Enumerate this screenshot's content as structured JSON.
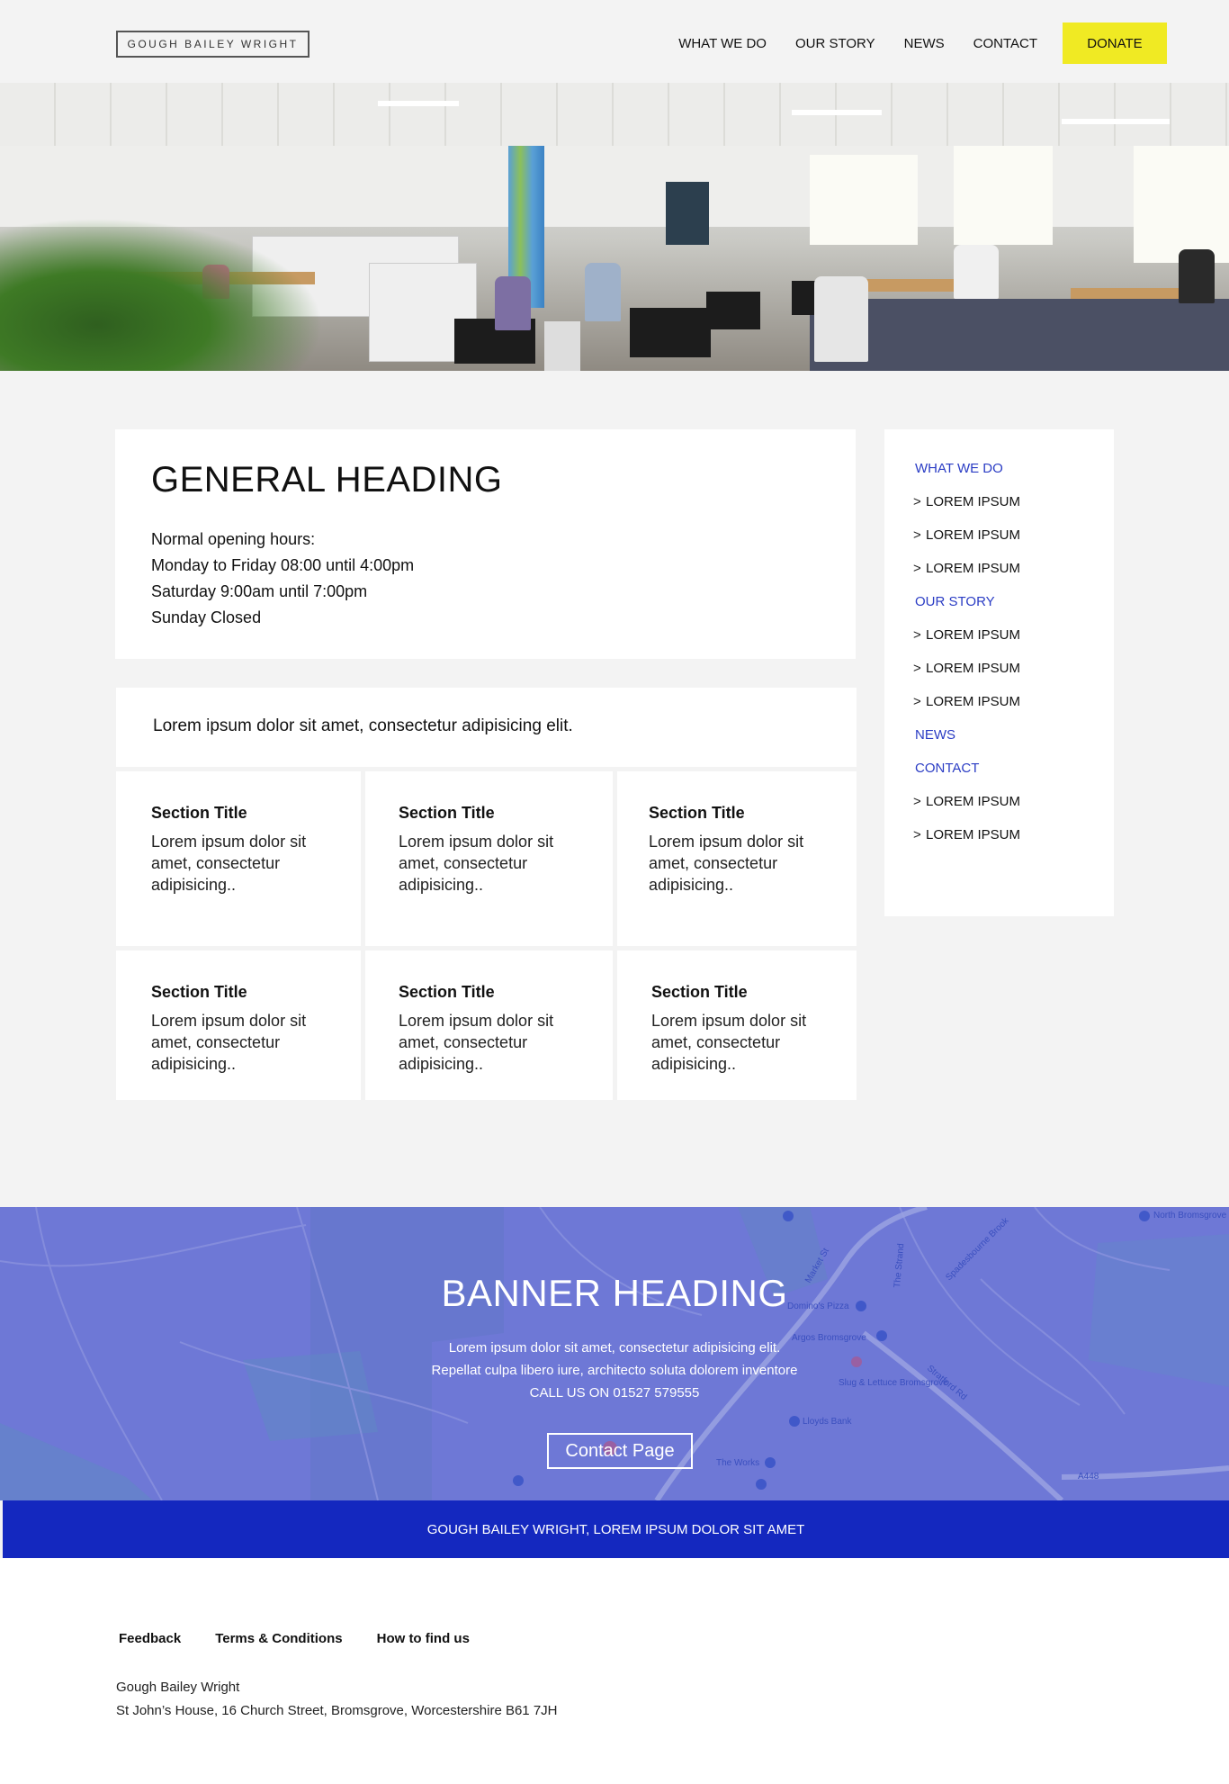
{
  "header": {
    "logo": "GOUGH BAILEY WRIGHT",
    "nav": [
      "WHAT WE DO",
      "OUR STORY",
      "NEWS",
      "CONTACT"
    ],
    "donate": "DONATE",
    "donate_color": "#f0ea23"
  },
  "general": {
    "heading": "GENERAL HEADING",
    "hours": [
      "Normal opening hours:",
      "Monday to Friday 08:00 until 4:00pm",
      "Saturday 9:00am until 7:00pm",
      "Sunday Closed"
    ]
  },
  "intro": "Lorem ipsum dolor sit amet, consectetur adipisicing elit.",
  "tiles": [
    {
      "title": "Section Title",
      "text": "Lorem ipsum dolor sit amet, consectetur adipisicing.."
    },
    {
      "title": "Section Title",
      "text": "Lorem ipsum dolor sit amet, consectetur adipisicing.."
    },
    {
      "title": "Section Title",
      "text": "Lorem ipsum dolor sit amet, consectetur adipisicing.."
    },
    {
      "title": "Section Title",
      "text": "Lorem ipsum dolor sit amet, consectetur adipisicing.."
    },
    {
      "title": "Section Title",
      "text": "Lorem ipsum dolor sit amet, consectetur adipisicing.."
    },
    {
      "title": "Section Title",
      "text": "Lorem ipsum dolor sit amet, consectetur adipisicing.."
    }
  ],
  "sidebar": {
    "chevron": ">",
    "items": [
      {
        "label": "WHAT WE DO",
        "type": "head"
      },
      {
        "label": "LOREM IPSUM",
        "type": "sub"
      },
      {
        "label": "LOREM IPSUM",
        "type": "sub"
      },
      {
        "label": "LOREM IPSUM",
        "type": "sub"
      },
      {
        "label": "OUR STORY",
        "type": "head"
      },
      {
        "label": "LOREM IPSUM",
        "type": "sub"
      },
      {
        "label": "LOREM IPSUM",
        "type": "sub"
      },
      {
        "label": "LOREM IPSUM",
        "type": "sub"
      },
      {
        "label": "NEWS",
        "type": "head"
      },
      {
        "label": "CONTACT",
        "type": "head"
      },
      {
        "label": "LOREM IPSUM",
        "type": "sub"
      },
      {
        "label": "LOREM IPSUM",
        "type": "sub"
      }
    ],
    "accent_color": "#2a3cc4"
  },
  "banner": {
    "heading": "BANNER HEADING",
    "lines": [
      "Lorem ipsum dolor sit amet, consectetur adipisicing elit.",
      "Repellat culpa libero iure, architecto soluta dolorem inventore",
      "CALL US ON 01527 579555"
    ],
    "button": "Contact Page",
    "color": "#6e78d6",
    "map_labels": [
      "Market St",
      "The Strand",
      "Spadesbourne Brook",
      "Domino's Pizza",
      "Argos Bromsgrove",
      "Slug & Lettuce Bromsgrove",
      "Lloyds Bank",
      "The Works",
      "Stratford Rd",
      "A448",
      "North Bromsgrove School And Sixth"
    ]
  },
  "footer": {
    "bar_text": "GOUGH BAILEY WRIGHT, LOREM IPSUM DOLOR SIT AMET",
    "bar_color": "#1428bf",
    "links": [
      "Feedback",
      "Terms & Conditions",
      "How to find us"
    ],
    "address_lines": [
      "Gough Bailey Wright",
      "St John’s House, 16 Church Street, Bromsgrove, Worcestershire B61 7JH"
    ]
  }
}
